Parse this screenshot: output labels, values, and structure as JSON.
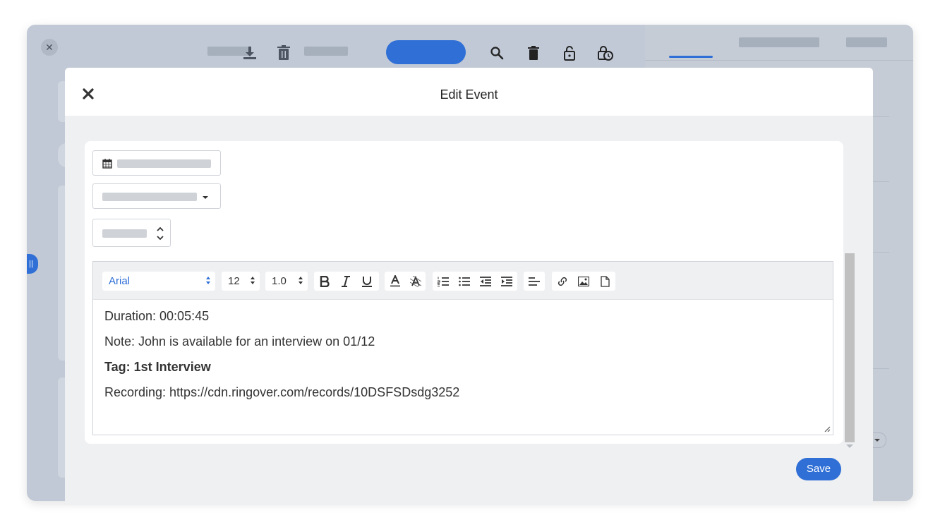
{
  "modal": {
    "title": "Edit Event",
    "save_label": "Save"
  },
  "toolbar": {
    "font_family": "Arial",
    "font_size": "12",
    "line_height": "1.0"
  },
  "content": {
    "lines": [
      "Duration: 00:05:45",
      "Note: John is available for an interview on 01/12",
      "Tag: 1st Interview",
      "Recording: https://cdn.ringover.com/records/10DSFSDsdg3252"
    ]
  },
  "colors": {
    "accent": "#2f6fd6",
    "backdrop": "#c1c9d6"
  },
  "icons": [
    "close-icon",
    "download-icon",
    "trash-icon",
    "search-icon",
    "delete-icon",
    "unlock-icon",
    "lock-clock-icon",
    "calendar-icon",
    "bold-icon",
    "italic-icon",
    "underline-icon",
    "font-color-icon",
    "highlight-icon",
    "ordered-list-icon",
    "unordered-list-icon",
    "outdent-icon",
    "indent-icon",
    "align-icon",
    "link-icon",
    "image-icon",
    "document-icon"
  ]
}
